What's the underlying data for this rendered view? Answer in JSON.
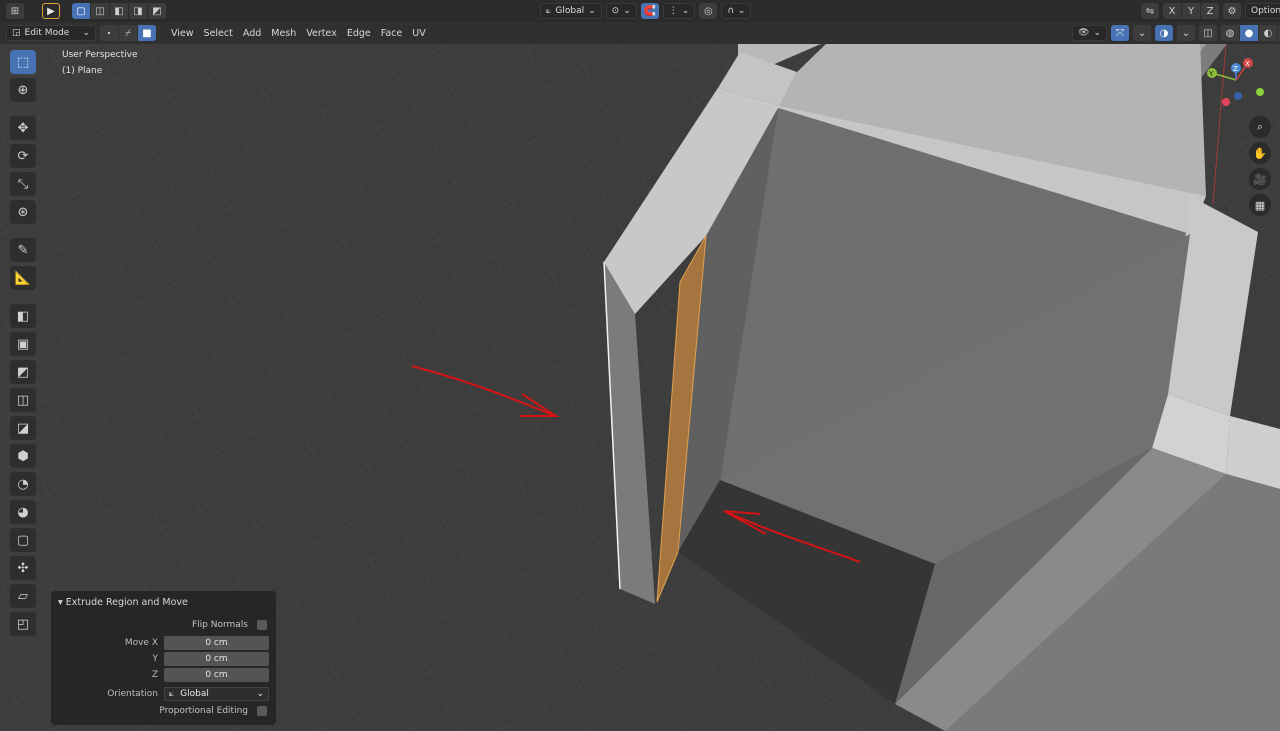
{
  "topbar": {
    "orientation_label": "Global",
    "axes": [
      "X",
      "Y",
      "Z"
    ],
    "options_label": "Options"
  },
  "header": {
    "mode_label": "Edit Mode",
    "menus": [
      "View",
      "Select",
      "Add",
      "Mesh",
      "Vertex",
      "Edge",
      "Face",
      "UV"
    ]
  },
  "viewport": {
    "view_name": "User Perspective",
    "object_name": "(1) Plane",
    "gizmo_axes": [
      "X",
      "Y",
      "Z"
    ]
  },
  "tools": [
    "select-box-icon",
    "cursor-icon",
    "move-icon",
    "rotate-icon",
    "scale-icon",
    "transform-icon",
    "annotate-icon",
    "measure-icon",
    "extrude-region-icon",
    "inset-faces-icon",
    "bevel-icon",
    "loop-cut-icon",
    "knife-icon",
    "poly-build-icon",
    "spin-icon",
    "smooth-icon",
    "edge-slide-icon",
    "shrink-fatten-icon",
    "shear-icon",
    "rip-region-icon"
  ],
  "operator_panel": {
    "title": "Extrude Region and Move",
    "flip_normals_label": "Flip Normals",
    "move_x_label": "Move X",
    "y_label": "Y",
    "z_label": "Z",
    "move_x_value": "0 cm",
    "move_y_value": "0 cm",
    "move_z_value": "0 cm",
    "orientation_label": "Orientation",
    "orientation_value": "Global",
    "proportional_label": "Proportional Editing"
  },
  "colors": {
    "selected_face": "#a6743f",
    "annotation": "#d41414",
    "accent": "#4772b3"
  }
}
